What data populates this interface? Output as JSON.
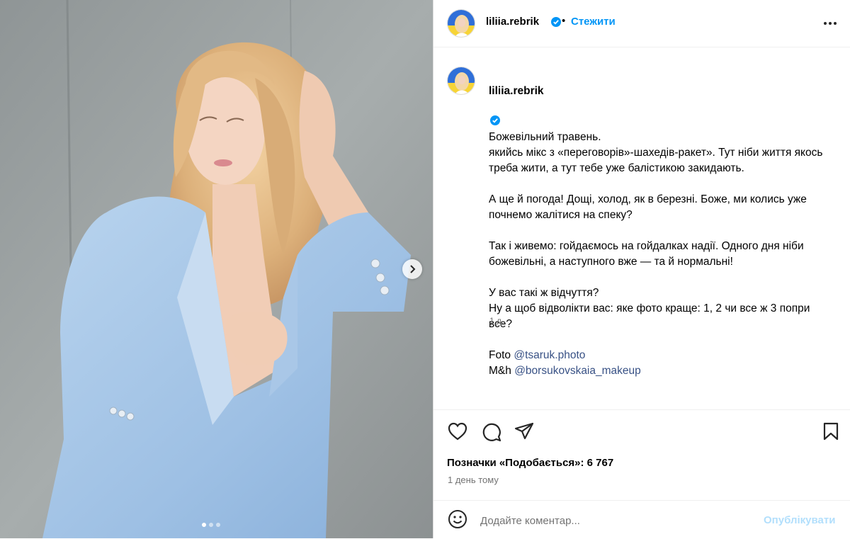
{
  "post": {
    "username": "liliia.rebrik",
    "follow_label": "Стежити",
    "separator": "•",
    "caption_first": "Божевільний травень.",
    "caption_paragraphs": [
      "якийсь мікс з «переговорів»-шахедів-ракет». Тут ніби життя якось треба жити, а тут тебе уже балістикою закидають.",
      "А ще й погода! Дощі, холод, як в березні. Боже, ми колись уже почнемо жалітися на спеку?",
      "Так і живемо: гойдаємось на гойдалках надії. Одного дня ніби божевільні, а наступного вже — та й нормальні!",
      "У вас такі ж відчуття?\nНу а щоб відволікти вас: яке фото краще: 1, 2 чи все ж 3 попри все?"
    ],
    "credits": {
      "photo_prefix": "Foto ",
      "photo_handle": "@tsaruk.photo",
      "makeup_prefix": "M&h ",
      "makeup_handle": "@borsukovskaia_makeup"
    },
    "caption_time": "1 д.",
    "likes_text": "Позначки «Подобається»: 6 767",
    "posted_ago": "1 день тому"
  },
  "comment": {
    "placeholder": "Додайте коментар...",
    "post_label": "Опублікувати"
  },
  "icons": {
    "verified": "verified-badge-icon",
    "more": "more-horizontal-icon",
    "like": "heart-icon",
    "comment": "comment-bubble-icon",
    "share": "paper-plane-icon",
    "save": "bookmark-icon",
    "emoji": "emoji-smile-icon",
    "next": "chevron-right-icon"
  },
  "carousel": {
    "count": 3,
    "current": 1
  },
  "colors": {
    "accent": "#0095f6",
    "link": "#385185",
    "verified": "#0095f6",
    "muted": "#737373",
    "post_disabled": "#b2dffc"
  }
}
